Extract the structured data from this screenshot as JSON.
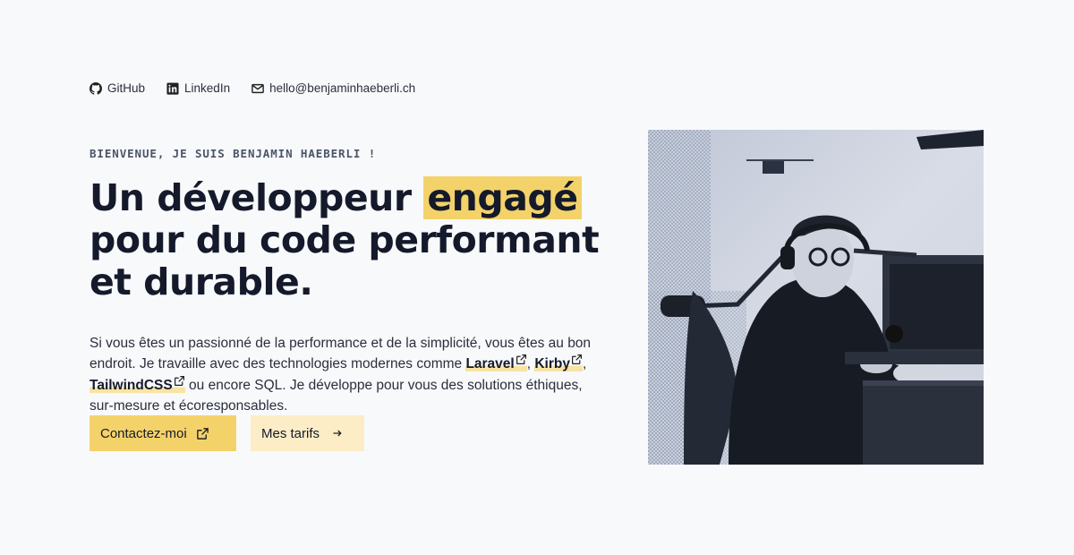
{
  "social": {
    "github": {
      "label": "GitHub",
      "icon": "github-icon"
    },
    "linkedin": {
      "label": "LinkedIn",
      "icon": "linkedin-icon"
    },
    "email": {
      "label": "hello@benjaminhaeberli.ch",
      "icon": "mail-icon"
    }
  },
  "hero": {
    "eyebrow": "BIENVENUE, JE SUIS BENJAMIN HAEBERLI !",
    "title_part1": "Un développeur ",
    "title_highlight": "engagé",
    "title_part2": " pour du code performant et durable.",
    "intro_before": "Si vous êtes un passionné de la performance et de la simplicité, vous êtes au bon endroit. Je travaille avec des technologies modernes comme ",
    "tech_links": [
      "Laravel",
      "Kirby",
      "TailwindCSS"
    ],
    "sep": ", ",
    "intro_after": " ou encore SQL. Je développe pour vous des solutions éthiques, sur-mesure et écoresponsables."
  },
  "buttons": {
    "contact": {
      "label": "Contactez-moi",
      "icon": "external-link-icon"
    },
    "pricing": {
      "label": "Mes tarifs",
      "icon": "arrow-right-icon"
    }
  },
  "colors": {
    "accent": "#f4d26a",
    "accent_light": "#fcedc6",
    "background": "#f8f9fb",
    "text": "#141a2b"
  }
}
